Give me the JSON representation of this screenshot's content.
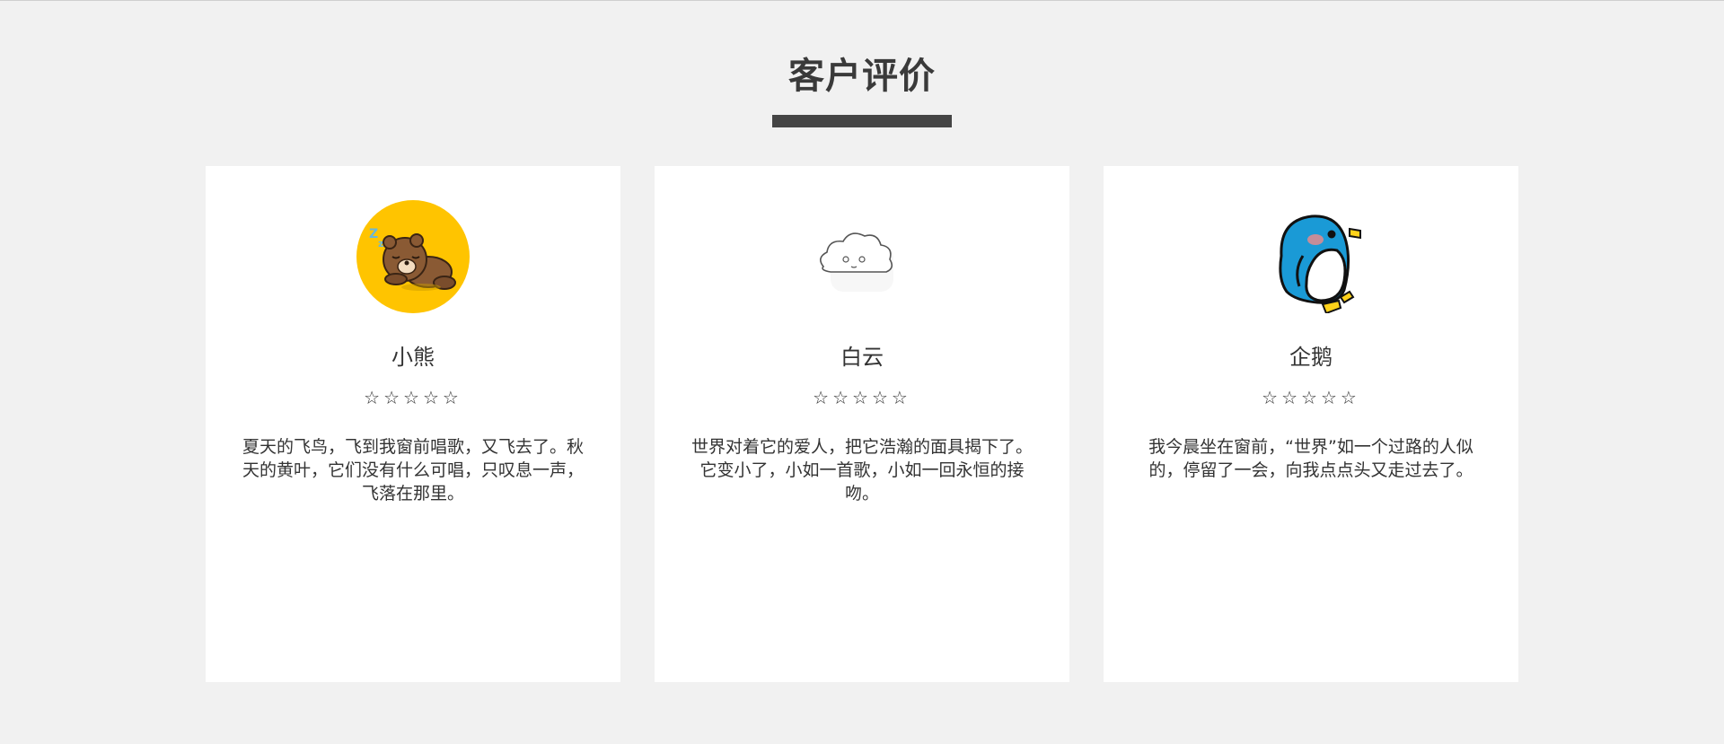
{
  "section": {
    "title": "客户评价"
  },
  "cards": [
    {
      "name": "小熊",
      "stars": "☆☆☆☆☆",
      "rating": 0,
      "review": "夏天的飞鸟，飞到我窗前唱歌，又飞去了。秋天的黄叶，它们没有什么可唱，只叹息一声，飞落在那里。",
      "avatar_icon": "sleeping-bear-avatar"
    },
    {
      "name": "白云",
      "stars": "☆☆☆☆☆",
      "rating": 0,
      "review": "世界对着它的爱人，把它浩瀚的面具揭下了。它变小了，小如一首歌，小如一回永恒的接吻。",
      "avatar_icon": "cloud-avatar"
    },
    {
      "name": "企鹅",
      "stars": "☆☆☆☆☆",
      "rating": 0,
      "review": "我今晨坐在窗前，“世界”如一个过路的人似的，停留了一会，向我点点头又走过去了。",
      "avatar_icon": "penguin-avatar"
    }
  ],
  "colors": {
    "background": "#f1f1f1",
    "card": "#ffffff",
    "title_bar": "#454545",
    "bear_circle": "#ffc400",
    "penguin_blue": "#1a9ad6"
  }
}
